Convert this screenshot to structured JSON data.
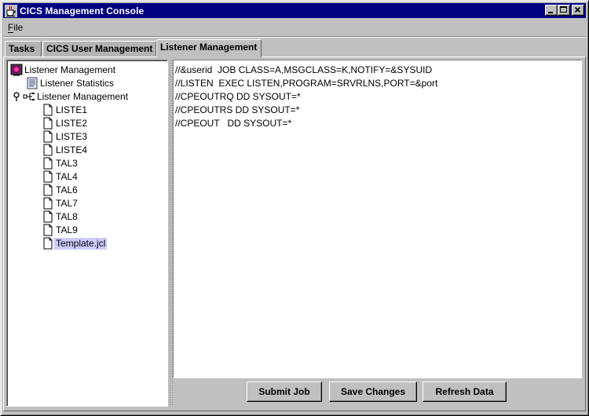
{
  "window": {
    "title": "CICS Management Console"
  },
  "menu": {
    "file_label": "File"
  },
  "tabs": [
    {
      "label": "Tasks"
    },
    {
      "label": "CICS User Management"
    },
    {
      "label": "Listener Management"
    }
  ],
  "tree": {
    "root_label": "Listener Management",
    "statistics_label": "Listener Statistics",
    "management_label": "Listener Management",
    "files": [
      "LISTE1",
      "LISTE2",
      "LISTE3",
      "LISTE4",
      "TAL3",
      "TAL4",
      "TAL6",
      "TAL7",
      "TAL8",
      "TAL9",
      "Template.jcl"
    ],
    "selected": "Template.jcl"
  },
  "editor": {
    "lines": [
      "//&userid  JOB CLASS=A,MSGCLASS=K,NOTIFY=&SYSUID",
      "//LISTEN  EXEC LISTEN,PROGRAM=SRVRLNS,PORT=&port",
      "//CPEOUTRQ DD SYSOUT=*",
      "//CPEOUTRS DD SYSOUT=*",
      "//CPEOUT   DD SYSOUT=*"
    ]
  },
  "buttons": {
    "submit": "Submit Job",
    "save": "Save Changes",
    "refresh": "Refresh Data"
  }
}
